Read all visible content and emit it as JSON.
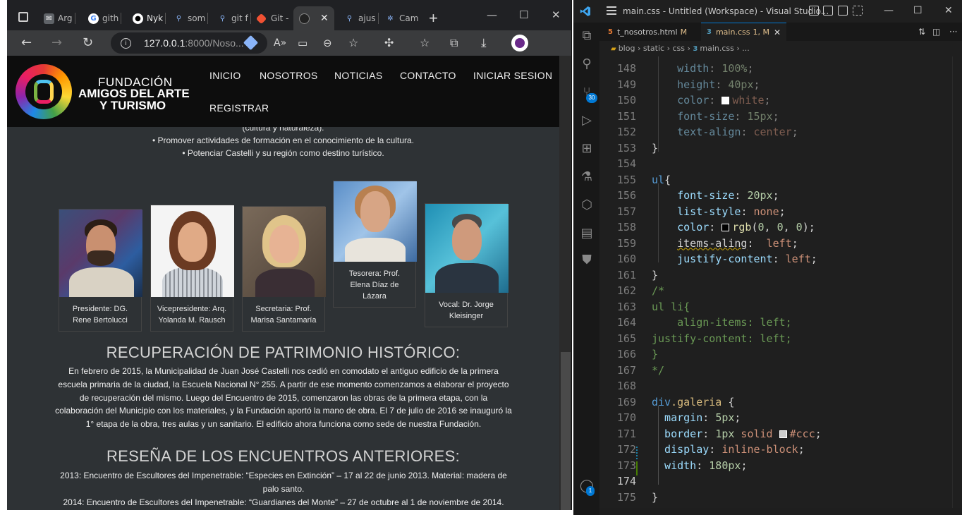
{
  "browser": {
    "tabs": [
      {
        "label": "Arg",
        "icon": "mail-icon"
      },
      {
        "label": "gith",
        "icon": "google-icon"
      },
      {
        "label": "Nyk",
        "icon": "github-icon"
      },
      {
        "label": "som",
        "icon": "search-icon"
      },
      {
        "label": "git f",
        "icon": "search-icon"
      },
      {
        "label": "Git -",
        "icon": "git-icon"
      },
      {
        "label": "",
        "icon": "site-icon",
        "active": true
      },
      {
        "label": "ajus",
        "icon": "search-icon"
      },
      {
        "label": "Cam",
        "icon": "settings-icon"
      }
    ],
    "url_host": "127.0.0.1",
    "url_path": ":8000/Noso..."
  },
  "site": {
    "logo": {
      "line1": "FUNDACIÓN",
      "line2": "AMIGOS DEL ARTE",
      "line3": "Y TURISMO"
    },
    "nav": [
      "INICIO",
      "NOSOTROS",
      "NOTICIAS",
      "CONTACTO",
      "INICIAR SESION",
      "REGISTRAR"
    ],
    "top_lines": [
      "(cultura y naturaleza).",
      "• Promover actividades de formación en el conocimiento de la cultura.",
      "• Potenciar Castelli y su región como destino turístico."
    ],
    "gallery": [
      {
        "caption_l1": "Presidente: DG.",
        "caption_l2": "Rene Bertolucci",
        "caption_l3": ""
      },
      {
        "caption_l1": "Vicepresidente: Arq.",
        "caption_l2": "Yolanda M. Rausch",
        "caption_l3": ""
      },
      {
        "caption_l1": "Secretaria: Prof.",
        "caption_l2": "Marisa Santamaría",
        "caption_l3": ""
      },
      {
        "caption_l1": "Tesorera: Prof.",
        "caption_l2": "Elena Díaz de",
        "caption_l3": "Lázara"
      },
      {
        "caption_l1": "Vocal: Dr. Jorge",
        "caption_l2": "Kleisinger",
        "caption_l3": ""
      }
    ],
    "section1_title": "RECUPERACIÓN DE PATRIMONIO HISTÓRICO:",
    "section1_lines": [
      "En febrero de 2015, la Municipalidad de Juan José Castelli nos cedió en comodato el antiguo edificio de la primera",
      "escuela primaria de la ciudad, la Escuela Nacional N° 255. A partir de ese momento comenzamos a elaborar el proyecto",
      "de recuperación del mismo. Luego del Encuentro de 2015, comenzaron las obras de la primera etapa, con la",
      "colaboración del Municipio con los materiales, y la Fundación aportó la mano de obra. El 7 de julio de 2016 se inauguró la",
      "1° etapa de la obra, tres aulas y un sanitario. El edificio ahora funciona como sede de nuestra Fundación."
    ],
    "section2_title": "RESEÑA DE LOS ENCUENTROS ANTERIORES:",
    "section2_lines": [
      "2013: Encuentro de Escultores del Impenetrable: “Especies en Extinción” – 17 al 22 de junio 2013. Material: madera de",
      "palo santo.",
      "2014: Encuentro de Escultores del Impenetrable: “Guardianes del Monte” – 27 de octubre al 1 de noviembre de 2014."
    ]
  },
  "vscode": {
    "title": "main.css - Untitled (Workspace) - Visual Studio...",
    "tabs": [
      {
        "file": "t_nosotros.html",
        "status": "M",
        "icon": "html-file-icon",
        "color": "#e37933"
      },
      {
        "file": "main.css",
        "status": "1, M",
        "icon": "css-file-icon",
        "color": "#519aba",
        "active": true
      }
    ],
    "breadcrumbs": [
      "blog",
      "static",
      "css",
      "main.css",
      "..."
    ],
    "scm_badge": "30",
    "accounts_badge": "1",
    "lines": [
      {
        "n": "148",
        "tokens": [
          [
            "prop",
            "    width"
          ],
          [
            "punc",
            ": "
          ],
          [
            "num",
            "100%"
          ],
          [
            "punc",
            ";"
          ]
        ]
      },
      {
        "n": "149",
        "tokens": [
          [
            "prop",
            "    height"
          ],
          [
            "punc",
            ": "
          ],
          [
            "num",
            "40px"
          ],
          [
            "punc",
            ";"
          ]
        ]
      },
      {
        "n": "150",
        "tokens": [
          [
            "prop",
            "    color"
          ],
          [
            "punc",
            ": "
          ],
          [
            "swatch",
            "#ffffff"
          ],
          [
            "val",
            "white"
          ],
          [
            "punc",
            ";"
          ]
        ]
      },
      {
        "n": "151",
        "tokens": [
          [
            "prop",
            "    font-size"
          ],
          [
            "punc",
            ": "
          ],
          [
            "num",
            "15px"
          ],
          [
            "punc",
            ";"
          ]
        ]
      },
      {
        "n": "152",
        "tokens": [
          [
            "prop",
            "    text-align"
          ],
          [
            "punc",
            ": "
          ],
          [
            "val",
            "center"
          ],
          [
            "punc",
            ";"
          ]
        ]
      },
      {
        "n": "153",
        "tokens": [
          [
            "punc",
            "}"
          ]
        ]
      },
      {
        "n": "154",
        "tokens": []
      },
      {
        "n": "155",
        "tokens": [
          [
            "tagc",
            "ul"
          ],
          [
            "punc",
            "{"
          ]
        ]
      },
      {
        "n": "156",
        "tokens": [
          [
            "prop",
            "    font-size"
          ],
          [
            "punc",
            ": "
          ],
          [
            "num",
            "20px"
          ],
          [
            "punc",
            ";"
          ]
        ]
      },
      {
        "n": "157",
        "tokens": [
          [
            "prop",
            "    list-style"
          ],
          [
            "punc",
            ": "
          ],
          [
            "val",
            "none"
          ],
          [
            "punc",
            ";"
          ]
        ]
      },
      {
        "n": "158",
        "tokens": [
          [
            "prop",
            "    color"
          ],
          [
            "punc",
            ": "
          ],
          [
            "swatch",
            "#000000"
          ],
          [
            "fn",
            "rgb"
          ],
          [
            "punc",
            "("
          ],
          [
            "num",
            "0"
          ],
          [
            "punc",
            ", "
          ],
          [
            "num",
            "0"
          ],
          [
            "punc",
            ", "
          ],
          [
            "num",
            "0"
          ],
          [
            "punc",
            ");"
          ]
        ]
      },
      {
        "n": "159",
        "tokens": [
          [
            "punc",
            "    "
          ],
          [
            "squig",
            "items-aling"
          ],
          [
            "punc",
            ":  "
          ],
          [
            "val",
            "left"
          ],
          [
            "punc",
            ";"
          ]
        ]
      },
      {
        "n": "160",
        "tokens": [
          [
            "prop",
            "    justify-content"
          ],
          [
            "punc",
            ": "
          ],
          [
            "val",
            "left"
          ],
          [
            "punc",
            ";"
          ]
        ]
      },
      {
        "n": "161",
        "tokens": [
          [
            "punc",
            "}"
          ]
        ]
      },
      {
        "n": "162",
        "tokens": [
          [
            "cmt",
            "/*"
          ]
        ]
      },
      {
        "n": "163",
        "tokens": [
          [
            "cmt",
            "ul li{"
          ]
        ]
      },
      {
        "n": "164",
        "tokens": [
          [
            "cmt",
            "    align-items: left;"
          ]
        ]
      },
      {
        "n": "165",
        "tokens": [
          [
            "cmt",
            "justify-content: left;"
          ]
        ]
      },
      {
        "n": "166",
        "tokens": [
          [
            "cmt",
            "}"
          ]
        ]
      },
      {
        "n": "167",
        "tokens": [
          [
            "cmt",
            "*/"
          ]
        ]
      },
      {
        "n": "168",
        "tokens": []
      },
      {
        "n": "169",
        "tokens": [
          [
            "tagc",
            "div"
          ],
          [
            "sel",
            ".galeria"
          ],
          [
            "punc",
            " {"
          ]
        ]
      },
      {
        "n": "170",
        "tokens": [
          [
            "prop",
            "  margin"
          ],
          [
            "punc",
            ": "
          ],
          [
            "num",
            "5px"
          ],
          [
            "punc",
            ";"
          ]
        ]
      },
      {
        "n": "171",
        "tokens": [
          [
            "prop",
            "  border"
          ],
          [
            "punc",
            ": "
          ],
          [
            "num",
            "1px"
          ],
          [
            "val",
            " solid "
          ],
          [
            "swatch",
            "#cccccc"
          ],
          [
            "val",
            "#ccc"
          ],
          [
            "punc",
            ";"
          ]
        ]
      },
      {
        "n": "172",
        "tokens": [
          [
            "prop",
            "  display"
          ],
          [
            "punc",
            ": "
          ],
          [
            "val",
            "inline-block"
          ],
          [
            "punc",
            ";"
          ]
        ]
      },
      {
        "n": "173",
        "tokens": [
          [
            "prop",
            "  width"
          ],
          [
            "punc",
            ": "
          ],
          [
            "num",
            "180px"
          ],
          [
            "punc",
            ";"
          ]
        ]
      },
      {
        "n": "174",
        "tokens": []
      },
      {
        "n": "175",
        "tokens": [
          [
            "punc",
            "}"
          ]
        ]
      }
    ]
  }
}
